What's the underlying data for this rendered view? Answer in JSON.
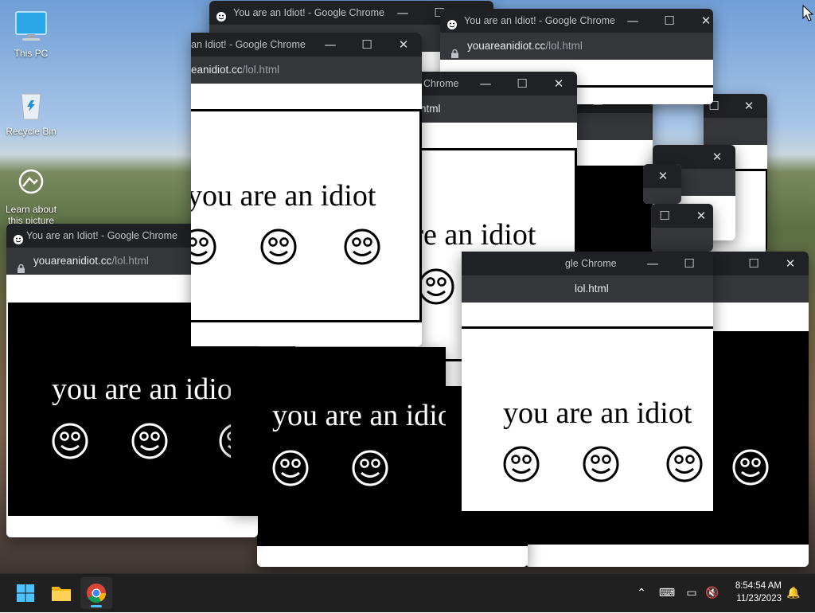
{
  "desktop": {
    "icons": [
      {
        "name": "this-pc",
        "label": "This PC"
      },
      {
        "name": "recycle-bin",
        "label": "Recycle Bin"
      },
      {
        "name": "learn-about-picture",
        "label": "Learn about this picture"
      }
    ]
  },
  "window": {
    "title": "You are an Idiot! - Google Chrome",
    "url_domain": "youareanidiot.cc",
    "url_path": "/lol.html",
    "message": "you are an idiot",
    "controls": {
      "minimize": "—",
      "maximize": "☐",
      "close": "✕"
    }
  },
  "taskbar": {
    "apps": [
      {
        "name": "start",
        "icon": "windows-icon"
      },
      {
        "name": "file-explorer",
        "icon": "folder-icon"
      },
      {
        "name": "google-chrome",
        "icon": "chrome-icon",
        "active": true
      }
    ],
    "tray": {
      "time": "8:54:54 AM",
      "date": "11/23/2023"
    }
  },
  "colors": {
    "titlebar": "#202124",
    "addressbar": "#35363a",
    "taskbar": "#202020",
    "accent": "#4cc2ff"
  }
}
